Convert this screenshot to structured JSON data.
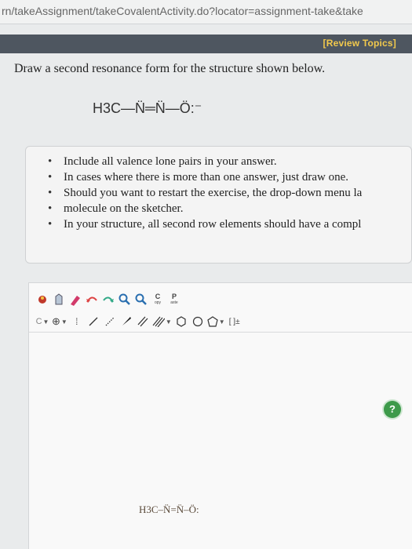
{
  "browser": {
    "url": "rn/takeAssignment/takeCovalentActivity.do?locator=assignment-take&take"
  },
  "header": {
    "review_topics": "[Review Topics]"
  },
  "question": {
    "prompt": "Draw a second resonance form for the structure shown below.",
    "structure": "H3C—N̈═N̈—Ö:⁻"
  },
  "instructions": {
    "items": [
      "Include all valence lone pairs in your answer.",
      "In cases where there is more than one answer, just draw one.",
      "Should you want to restart the exercise, the drop-down menu la",
      "molecule on the sketcher.",
      "In your structure, all second row elements should have a compl"
    ]
  },
  "sketcher": {
    "toolbar1": {
      "copy_label": "C",
      "copy_sub": "opy",
      "paste_label": "P",
      "paste_sub": "aste"
    },
    "toolbar2": {
      "element_label": "C",
      "charge_label": "⊕",
      "bracket_label": "[ ]±"
    },
    "help_label": "?",
    "canvas_molecule": "H3C–N̈=N̈–Ö:"
  }
}
